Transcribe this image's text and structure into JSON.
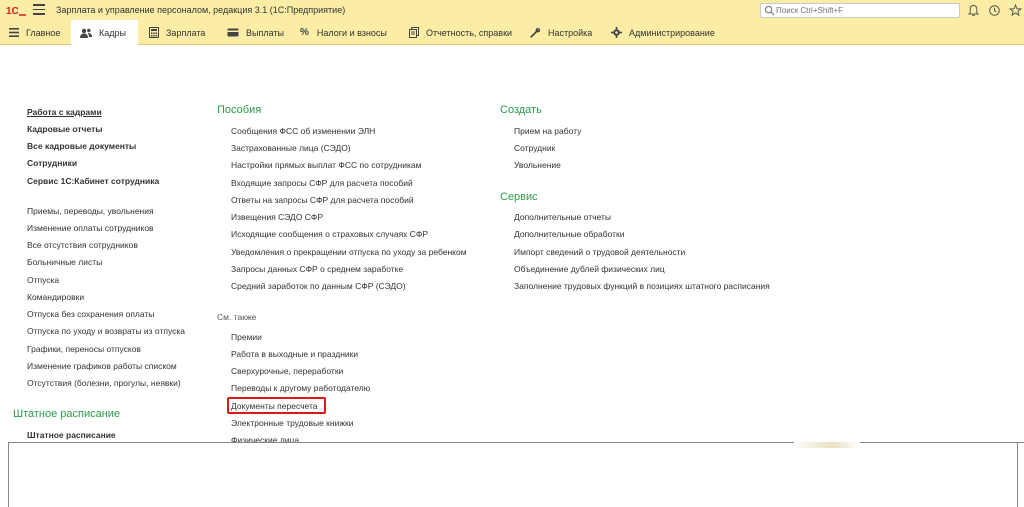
{
  "titlebar": {
    "app_title": "Зарплата и управление персоналом, редакция 3.1  (1С:Предприятие)",
    "search_placeholder": "Поиск Ctrl+Shift+F"
  },
  "sections": [
    {
      "label": "Главное",
      "icon": "hamburger-icon"
    },
    {
      "label": "Кадры",
      "icon": "people-icon",
      "active": true
    },
    {
      "label": "Зарплата",
      "icon": "calculator-icon"
    },
    {
      "label": "Выплаты",
      "icon": "wallet-icon"
    },
    {
      "label": "Налоги и взносы",
      "icon": "percent-icon"
    },
    {
      "label": "Отчетность, справки",
      "icon": "reports-icon"
    },
    {
      "label": "Настройка",
      "icon": "wrench-icon"
    },
    {
      "label": "Администрирование",
      "icon": "gear-icon"
    }
  ],
  "left_column": {
    "bold_items": [
      "Работа с кадрами",
      "Кадровые отчеты",
      "Все кадровые документы",
      "Сотрудники",
      "Сервис 1С:Кабинет сотрудника"
    ],
    "items": [
      "Приемы, переводы, увольнения",
      "Изменение оплаты сотрудников",
      "Все отсутствия сотрудников",
      "Больничные листы",
      "Отпуска",
      "Командировки",
      "Отпуска без сохранения оплаты",
      "Отпуска по уходу и возвраты из отпуска",
      "Графики, переносы отпусков",
      "Изменение графиков работы списком",
      "Отсутствия (болезни, прогулы, неявки)"
    ],
    "staff_heading": "Штатное расписание",
    "staff_items": [
      "Штатное расписание"
    ]
  },
  "middle_column": {
    "heading": "Пособия",
    "items": [
      "Сообщения ФСС об изменении ЭЛН",
      "Застрахованные лица (СЭДО)",
      "Настройки прямых выплат ФСС по сотрудникам",
      "Входящие запросы СФР для расчета пособий",
      "Ответы на запросы СФР для расчета пособий",
      "Извещения СЭДО СФР",
      "Исходящие сообщения о страховых случаях СФР",
      "Уведомления о прекращении отпуска по уходу за ребенком",
      "Запросы данных СФР о среднем заработке",
      "Средний заработок по данным СФР (СЭДО)"
    ],
    "see_also": "См. также",
    "see_also_items": [
      "Премии",
      "Работа в выходные и праздники",
      "Сверхурочные, переработки",
      "Переводы к другому работодателю",
      "Документы пересчета",
      "Электронные трудовые книжки",
      "Физические лица"
    ]
  },
  "right_column": {
    "create_heading": "Создать",
    "create_items": [
      "Прием на работу",
      "Сотрудник",
      "Увольнение"
    ],
    "service_heading": "Сервис",
    "service_items": [
      "Дополнительные отчеты",
      "Дополнительные обработки",
      "Импорт сведений о трудовой деятельности",
      "Объединение дублей физических лиц",
      "Заполнение трудовых функций в позициях штатного расписания"
    ]
  },
  "colors": {
    "accent_green": "#2e9a4a",
    "bar_yellow": "#fbeda6",
    "highlight_red": "#e0161b"
  }
}
